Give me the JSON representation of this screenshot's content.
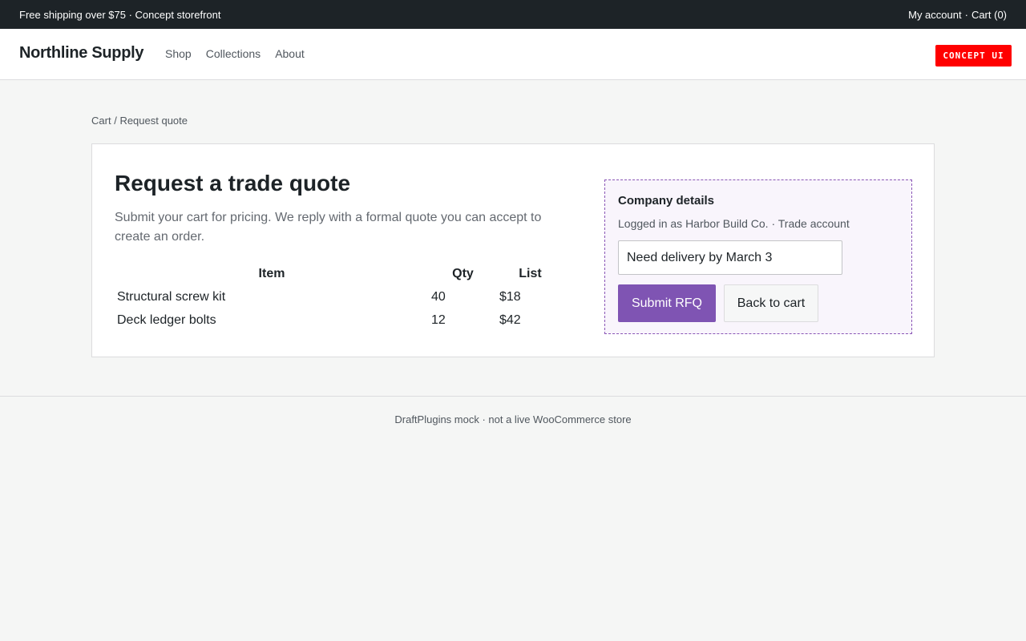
{
  "topbar": {
    "promo": "Free shipping over $75 · Concept storefront",
    "account_link": "My account",
    "separator": "·",
    "cart_link": "Cart (0)"
  },
  "header": {
    "brand": "Northline Supply",
    "nav": [
      "Shop",
      "Collections",
      "About"
    ],
    "badge": "CONCEPT UI",
    "badge_color": "#ff0000"
  },
  "breadcrumb": {
    "cart": "Cart",
    "separator": "/",
    "current": "Request quote"
  },
  "main": {
    "title": "Request a trade quote",
    "subtitle": "Submit your cart for pricing. We reply with a formal quote you can accept to create an order.",
    "table": {
      "headers": [
        "Item",
        "Qty",
        "List"
      ],
      "rows": [
        {
          "item": "Structural screw kit",
          "qty": "40",
          "list": "$18"
        },
        {
          "item": "Deck ledger bolts",
          "qty": "12",
          "list": "$42"
        }
      ]
    }
  },
  "company": {
    "heading": "Company details",
    "logged_in": "Logged in as Harbor Build Co. · Trade account",
    "note_value": "Need delivery by March 3",
    "submit_label": "Submit RFQ",
    "back_label": "Back to cart",
    "accent_color": "#7f54b3"
  },
  "footer": {
    "text": "DraftPlugins mock · not a live WooCommerce store"
  }
}
